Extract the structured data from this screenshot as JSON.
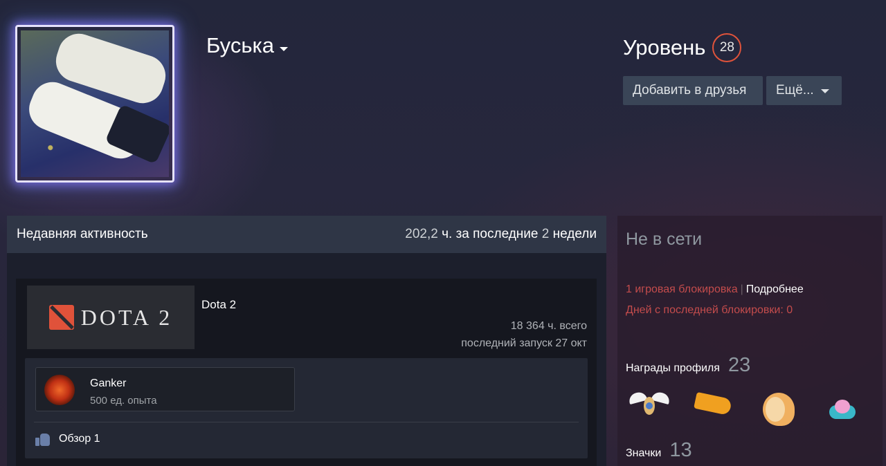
{
  "profile": {
    "persona_name": "Буська",
    "level_label": "Уровень",
    "level": "28",
    "add_friend_label": "Добавить в друзья",
    "more_label": "Ещё..."
  },
  "activity": {
    "title": "Недавняя активность",
    "hours_value": "202,2",
    "hours_text_1": "ч. за последние",
    "weeks_value": "2",
    "hours_text_2": "недели",
    "game": {
      "name": "Dota 2",
      "logo_text": "DOTA 2",
      "total_hours": "18 364 ч. всего",
      "last_played": "последний запуск 27 окт",
      "achievement": {
        "name": "Ganker",
        "xp": "500 ед. опыта"
      },
      "review_label": "Обзор 1"
    }
  },
  "sidebar": {
    "status": "Не в сети",
    "ban_text": "1 игровая блокировка",
    "ban_separator": "|",
    "ban_more": "Подробнее",
    "ban_days": "Дней с последней блокировки: 0",
    "awards_label": "Награды профиля",
    "awards_count": "23",
    "badges_label": "Значки",
    "badges_count": "13"
  },
  "colors": {
    "level_ring": "#e0533b",
    "ban_red": "#c44c4c",
    "button_bg": "#3a4557"
  }
}
